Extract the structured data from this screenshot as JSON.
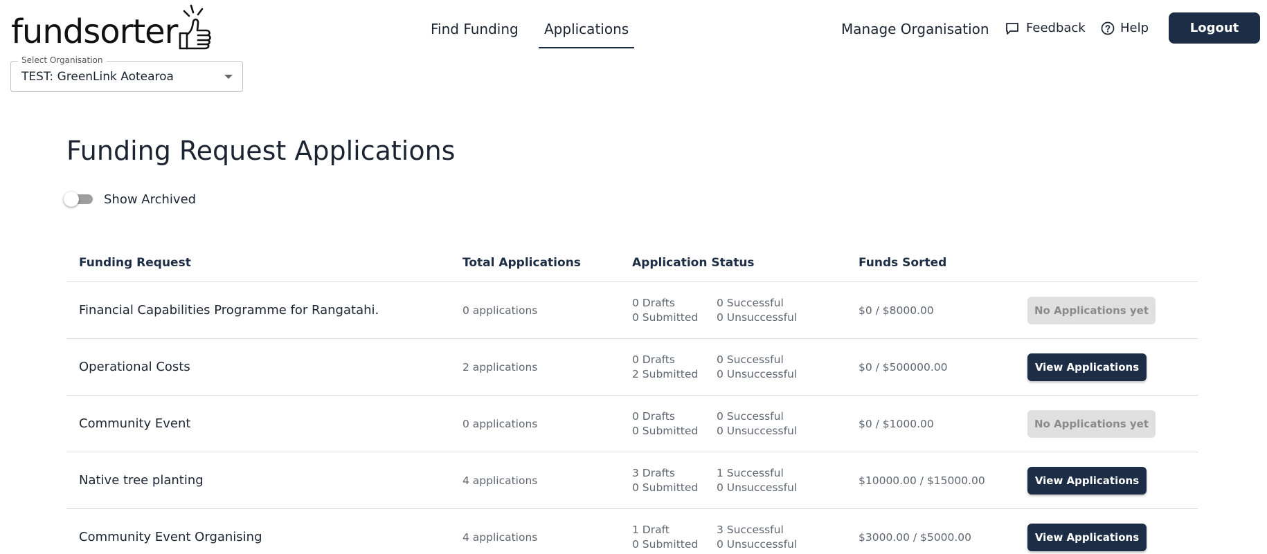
{
  "brand": {
    "logo_text": "fundsorter"
  },
  "nav": {
    "find_funding": "Find Funding",
    "applications": "Applications",
    "manage_organisation": "Manage Organisation",
    "feedback": "Feedback",
    "help": "Help",
    "logout": "Logout"
  },
  "org_select": {
    "label": "Select Organisation",
    "value": "TEST: GreenLink Aotearoa"
  },
  "page": {
    "title": "Funding Request Applications",
    "show_archived_label": "Show Archived",
    "show_archived_on": false
  },
  "table": {
    "headers": [
      "Funding Request",
      "Total Applications",
      "Application Status",
      "Funds Sorted",
      ""
    ],
    "rows": [
      {
        "name": "Financial Capabilities Programme for Rangatahi.",
        "total": "0 applications",
        "drafts": "0 Drafts",
        "successful": "0 Successful",
        "submitted": "0 Submitted",
        "unsuccessful": "0 Unsuccessful",
        "funds": "$0 / $8000.00",
        "action": "No Applications yet"
      },
      {
        "name": "Operational Costs",
        "total": "2 applications",
        "drafts": "0 Drafts",
        "successful": "0 Successful",
        "submitted": "2 Submitted",
        "unsuccessful": "0 Unsuccessful",
        "funds": "$0 / $500000.00",
        "action": "View Applications"
      },
      {
        "name": "Community Event",
        "total": "0 applications",
        "drafts": "0 Drafts",
        "successful": "0 Successful",
        "submitted": "0 Submitted",
        "unsuccessful": "0 Unsuccessful",
        "funds": "$0 / $1000.00",
        "action": "No Applications yet"
      },
      {
        "name": "Native tree planting",
        "total": "4 applications",
        "drafts": "3 Drafts",
        "successful": "1 Successful",
        "submitted": "0 Submitted",
        "unsuccessful": "0 Unsuccessful",
        "funds": "$10000.00 / $15000.00",
        "action": "View Applications"
      },
      {
        "name": "Community Event Organising",
        "total": "4 applications",
        "drafts": "1 Draft",
        "successful": "3 Successful",
        "submitted": "0 Submitted",
        "unsuccessful": "0 Unsuccessful",
        "funds": "$3000.00 / $5000.00",
        "action": "View Applications"
      }
    ]
  },
  "colors": {
    "primary": "#1c2d45",
    "disabled_bg": "#e0e0e0",
    "divider": "#dcdcdc"
  }
}
